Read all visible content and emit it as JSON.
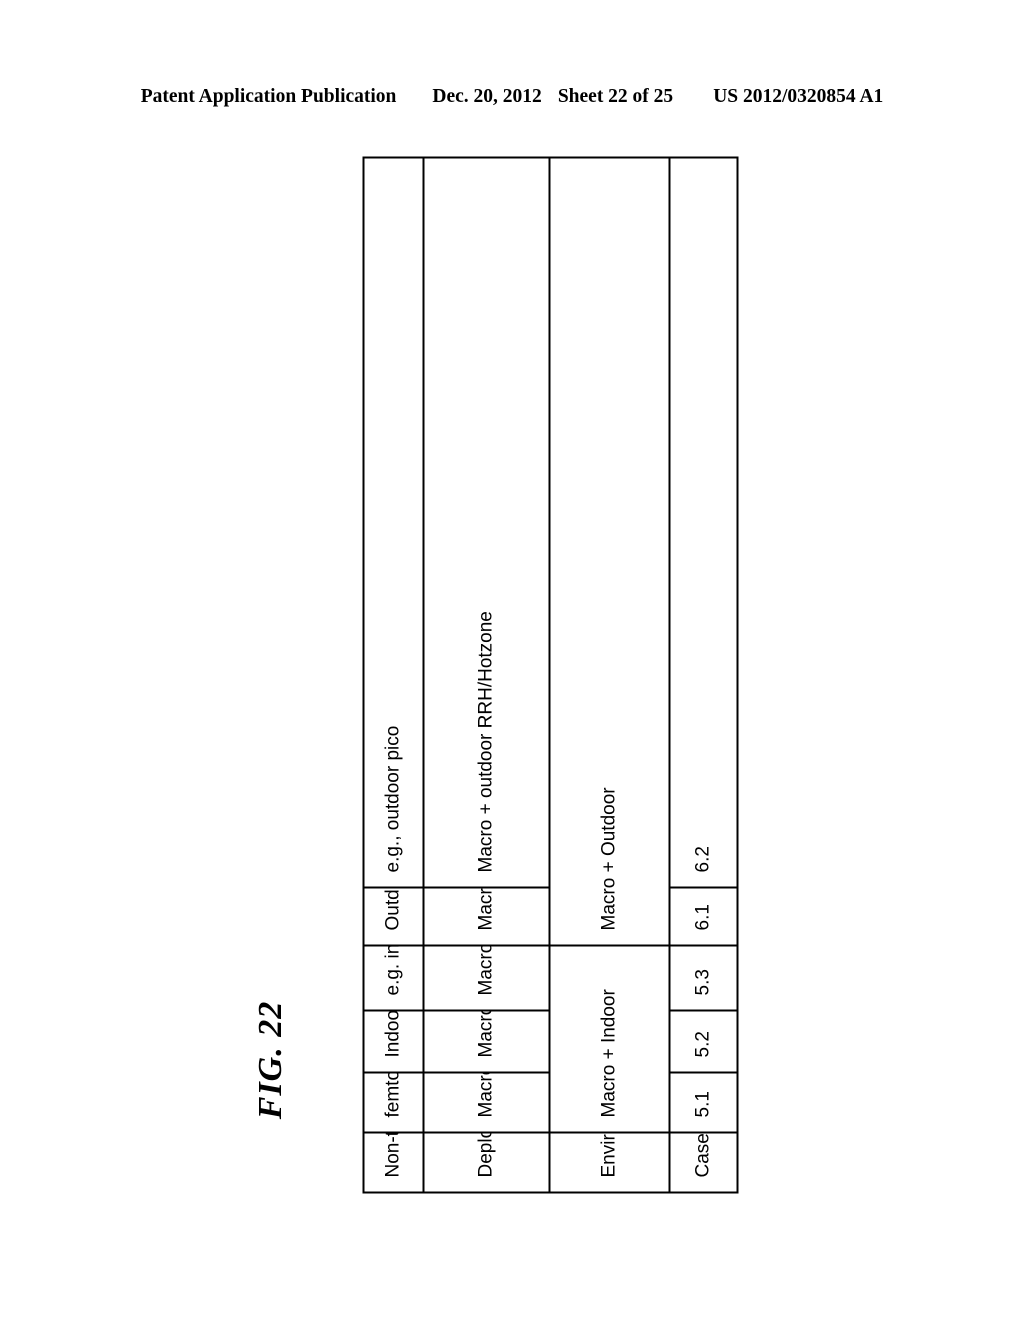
{
  "header": {
    "publication": "Patent Application Publication",
    "date": "Dec. 20, 2012",
    "sheet": "Sheet 22 of 25",
    "patent_number": "US 2012/0320854 A1"
  },
  "figure": {
    "label": "FIG. 22"
  },
  "table": {
    "row_headers": [
      "Non-traditional node",
      "Deployment Scenario",
      "Environment",
      "Case"
    ],
    "cases": [
      "5.1",
      "5.2",
      "5.3",
      "6.1",
      "6.2"
    ],
    "environments": [
      {
        "label": "Macro + Indoor",
        "span": 3
      },
      {
        "label": "Macro + Outdoor",
        "span": 2
      }
    ],
    "deployment_scenarios": [
      "Macro + femtocell",
      "Macro + indoor relay",
      "Macro + indoor RRH/Hotzone",
      "Macro + outdoor relay",
      "Macro + outdoor RRH/Hotzone"
    ],
    "non_traditional_nodes": [
      "femtocell",
      "Indoor relay",
      "e.g. indoor pico",
      "Outdoor relay",
      "e.g., outdoor pico"
    ]
  }
}
